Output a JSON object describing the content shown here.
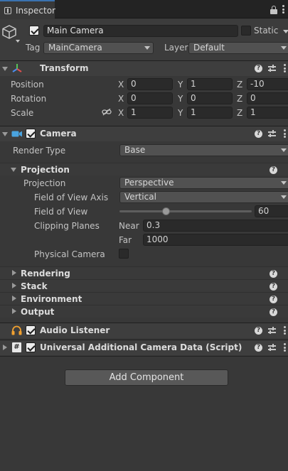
{
  "tab": {
    "title": "Inspector"
  },
  "object": {
    "active": true,
    "name": "Main Camera",
    "static_label": "Static",
    "tag_label": "Tag",
    "tag_value": "MainCamera",
    "layer_label": "Layer",
    "layer_value": "Default"
  },
  "transform": {
    "title": "Transform",
    "rows": [
      {
        "label": "Position",
        "x": "0",
        "y": "1",
        "z": "-10"
      },
      {
        "label": "Rotation",
        "x": "0",
        "y": "0",
        "z": "0"
      },
      {
        "label": "Scale",
        "x": "1",
        "y": "1",
        "z": "1"
      }
    ],
    "axis_x": "X",
    "axis_y": "Y",
    "axis_z": "Z"
  },
  "camera": {
    "title": "Camera",
    "enabled": true,
    "render_type_label": "Render Type",
    "render_type_value": "Base",
    "projection_section": "Projection",
    "projection_label": "Projection",
    "projection_value": "Perspective",
    "fov_axis_label": "Field of View Axis",
    "fov_axis_value": "Vertical",
    "fov_label": "Field of View",
    "fov_value": "60",
    "fov_fraction": 0.35,
    "clipping_label": "Clipping Planes",
    "near_label": "Near",
    "near_value": "0.3",
    "far_label": "Far",
    "far_value": "1000",
    "physical_label": "Physical Camera",
    "physical_checked": false,
    "sections": [
      "Rendering",
      "Stack",
      "Environment",
      "Output"
    ]
  },
  "audio_listener": {
    "title": "Audio Listener",
    "enabled": true
  },
  "urp_data": {
    "title": "Universal Additional Camera Data (Script)",
    "enabled": true
  },
  "add_component_label": "Add Component",
  "help_glyph": "?",
  "colors": {
    "accent_blue": "#4aa3df",
    "transform_red": "#e05050",
    "transform_green": "#58c458",
    "transform_blue": "#4a8ef0",
    "audio_orange": "#f0a030"
  }
}
